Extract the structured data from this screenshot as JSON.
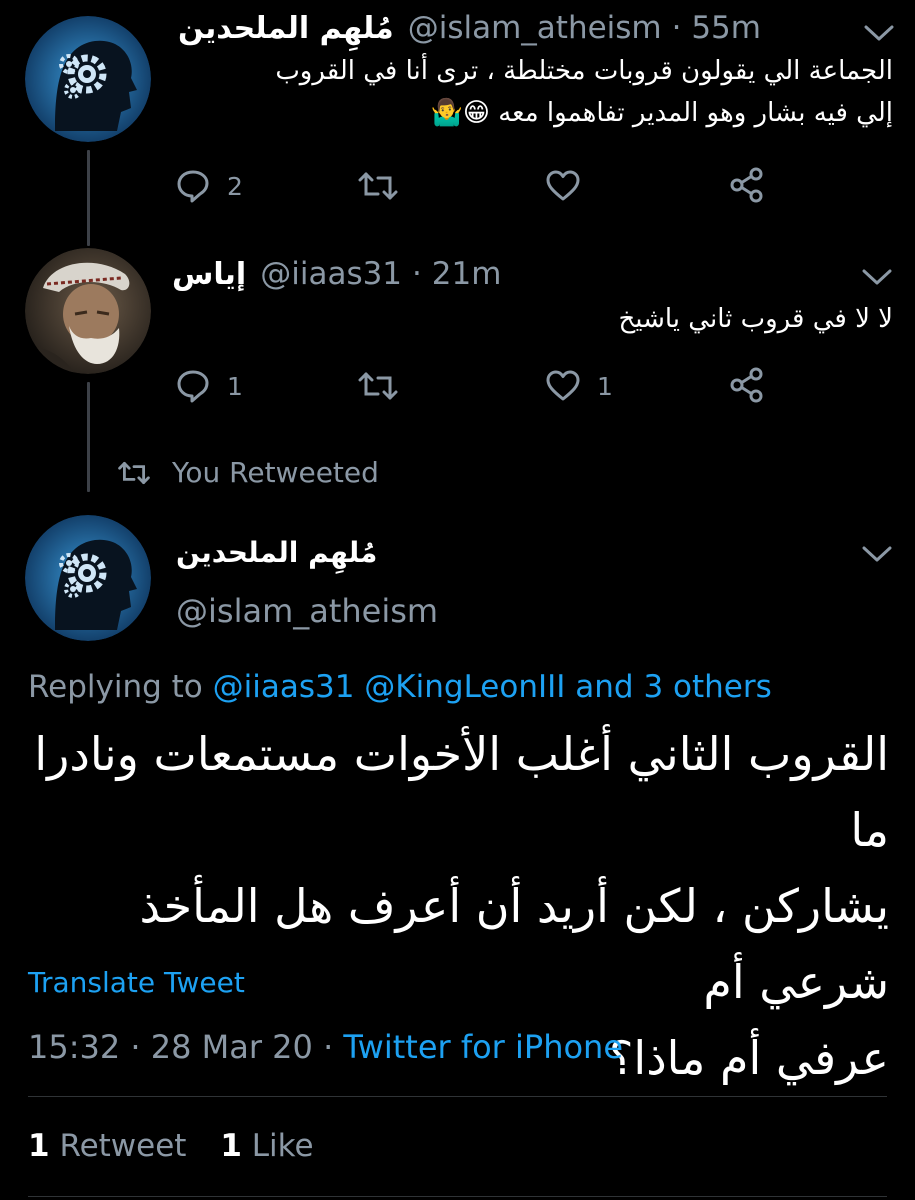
{
  "tweets": [
    {
      "name": "مُلهِم الملحدين",
      "handle": "@islam_atheism",
      "time": "· 55m",
      "text_line1": "الجماعة الي يقولون قروبات مختلطة ، ترى أنا في القروب",
      "text_line2": "إلي فيه بشار وهو المدير تفاهموا معه 😁🤷‍♂️",
      "reply_count": "2",
      "retweet_count": "",
      "like_count": "",
      "avatar_icon": "brain-gear-avatar-icon"
    },
    {
      "name": "إياس",
      "handle": "@iiaas31",
      "time": "· 21m",
      "text": "لا لا في قروب ثاني ياشيخ",
      "reply_count": "1",
      "retweet_count": "",
      "like_count": "1",
      "avatar_icon": "old-man-photo-avatar-icon"
    }
  ],
  "retweet_banner": "You Retweeted",
  "main_tweet": {
    "name": "مُلهِم الملحدين",
    "handle": "@islam_atheism",
    "replying_prefix": "Replying to",
    "replying_links": "@iiaas31 @KingLeonIII and 3 others",
    "line1": "القروب الثاني أغلب الأخوات مستمعات ونادرا ما",
    "line2": "يشاركن ، لكن أريد أن أعرف هل المأخذ شرعي أم",
    "line3": "عرفي أم ماذا؟",
    "translate": "Translate Tweet",
    "timestamp": "15:32 · 28 Mar 20 · ",
    "client": "Twitter for iPhone",
    "retweets_count": "1",
    "retweets_label": "Retweet",
    "likes_count": "1",
    "likes_label": "Like"
  },
  "colors": {
    "background": "#000000",
    "link": "#1da1f2",
    "muted": "#8b98a5",
    "thread_line": "#3d4148"
  }
}
